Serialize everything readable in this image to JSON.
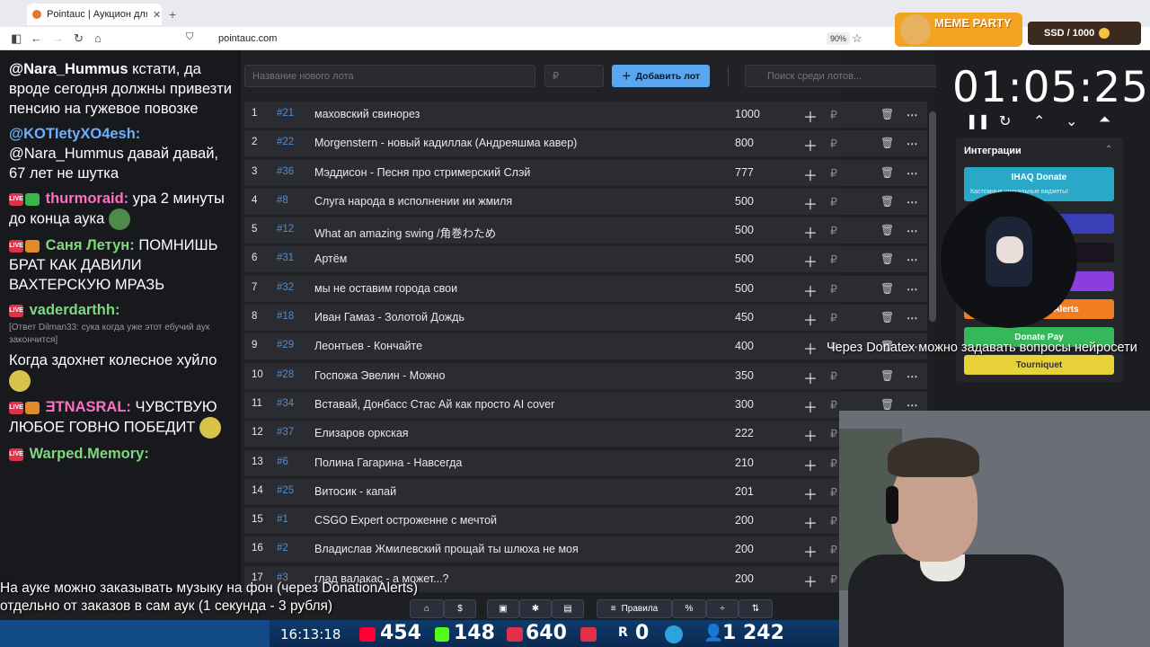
{
  "browser": {
    "tab_title": "Pointauc | Аукцион для стримера",
    "url": "pointauc.com",
    "zoom": "90%"
  },
  "chat": [
    {
      "type": "msg",
      "author": "@Nara_Hummus",
      "author_color": "#ffffff",
      "text": "кстати, да вроде сегодня должны привезти пенсию на гужевое повозке",
      "prefix": ""
    },
    {
      "type": "msg",
      "author": "@KOTIetyXO4esh:",
      "author_color": "#6ab0ff",
      "text": "@Nara_Hummus давай давай, 67 лет не шутка",
      "prefix": ""
    },
    {
      "type": "msg",
      "author": "thurmoraid:",
      "author_color": "#ff6ec7",
      "text": "ура 2 минуты до конца аука",
      "prefix": "LIVE"
    },
    {
      "type": "msg",
      "author": "Саня Летун:",
      "author_color": "#7dd97d",
      "text": "ПОМНИШЬ БРАТ КАК ДАВИЛИ ВАХТЕРСКУЮ МРАЗЬ",
      "prefix": "LIVE"
    },
    {
      "type": "msg",
      "author": "vaderdarthh:",
      "author_color": "#7dd97d",
      "text": "",
      "prefix": "LIVE"
    },
    {
      "type": "reply",
      "text": "[Ответ Dilman33: сука когда уже этот ебучий аук закончится]"
    },
    {
      "type": "msg",
      "author": "",
      "author_color": "#ffffff",
      "text": "Когда здохнет колесное хуйло",
      "prefix": ""
    },
    {
      "type": "msg",
      "author": "ƎTNASRAL:",
      "author_color": "#ff6ec7",
      "text": "ЧУВСТВУЮ ЛЮБОЕ ГОВНО ПОБЕДИТ",
      "prefix": "LIVE"
    },
    {
      "type": "msg",
      "author": "Warped.Memory:",
      "author_color": "#7dd97d",
      "text": "",
      "prefix": "LIVE"
    }
  ],
  "form": {
    "lot_placeholder": "Название нового лота",
    "amount_placeholder": "₽",
    "add_label": "Добавить лот",
    "search_placeholder": "Поиск среди лотов..."
  },
  "lots": [
    {
      "n": "1",
      "id": "#21",
      "name": "маховский свинорез",
      "amount": "1000"
    },
    {
      "n": "2",
      "id": "#22",
      "name": "Morgenstern - новый кадиллак (Андреяшма кавер)",
      "amount": "800"
    },
    {
      "n": "3",
      "id": "#36",
      "name": "Мэддисон - Песня про стримерский Слэй",
      "amount": "777"
    },
    {
      "n": "4",
      "id": "#8",
      "name": "Слуга народа в исполнении ии жмиля",
      "amount": "500"
    },
    {
      "n": "5",
      "id": "#12",
      "name": "What an amazing swing /角巻わため",
      "amount": "500"
    },
    {
      "n": "6",
      "id": "#31",
      "name": "Артём",
      "amount": "500"
    },
    {
      "n": "7",
      "id": "#32",
      "name": "мы не оставим города свои",
      "amount": "500"
    },
    {
      "n": "8",
      "id": "#18",
      "name": "Иван Гамаз - Золотой Дождь",
      "amount": "450"
    },
    {
      "n": "9",
      "id": "#29",
      "name": "Леонтьев - Кончайте",
      "amount": "400"
    },
    {
      "n": "10",
      "id": "#28",
      "name": "Госпожа Эвелин - Можно",
      "amount": "350"
    },
    {
      "n": "11",
      "id": "#34",
      "name": "Вставай, Донбасс Стас Ай как просто AI cover",
      "amount": "300"
    },
    {
      "n": "12",
      "id": "#37",
      "name": "Елизаров оркская",
      "amount": "222"
    },
    {
      "n": "13",
      "id": "#6",
      "name": "Полина Гагарина - Навсегда",
      "amount": "210"
    },
    {
      "n": "14",
      "id": "#25",
      "name": "Витосик - капай",
      "amount": "201"
    },
    {
      "n": "15",
      "id": "#1",
      "name": "CSGO Expert остроженне с мечтой",
      "amount": "200"
    },
    {
      "n": "16",
      "id": "#2",
      "name": "Владислав Жмилевский прощай ты шлюха не моя",
      "amount": "200"
    },
    {
      "n": "17",
      "id": "#3",
      "name": "глад валакас - а может...?",
      "amount": "200"
    }
  ],
  "timer": {
    "value": "01:05:25"
  },
  "integrations": {
    "title": "Интеграции",
    "items": [
      {
        "label": "IHAQ Donate",
        "sub": "Кастомные уникальные виджеты!",
        "color": "#2aa8c8"
      },
      {
        "label": "Donate Pay",
        "color": "#34b85a"
      },
      {
        "label": "Tourniquet",
        "color": "#e8d23a"
      },
      {
        "label": "Alerts",
        "color": "#f07d22"
      }
    ]
  },
  "overlay": {
    "meme_party": "MEME PARTY",
    "ssd": "SSD / 1000",
    "donatex_text": "Через Donatex можно задавать вопросы нейросети",
    "caption_line1": "На ауке можно заказывать музыку на фон (через DonationAlerts)",
    "caption_line2": "отдельно от заказов в сам аук (1 секунда - 3 рубля)"
  },
  "toolbar": {
    "rules_label": "Правила"
  },
  "stats": {
    "clock": "16:13:18",
    "youtube": "454",
    "kick": "148",
    "vk": "640",
    "rutube": "0",
    "total": "1 242"
  }
}
